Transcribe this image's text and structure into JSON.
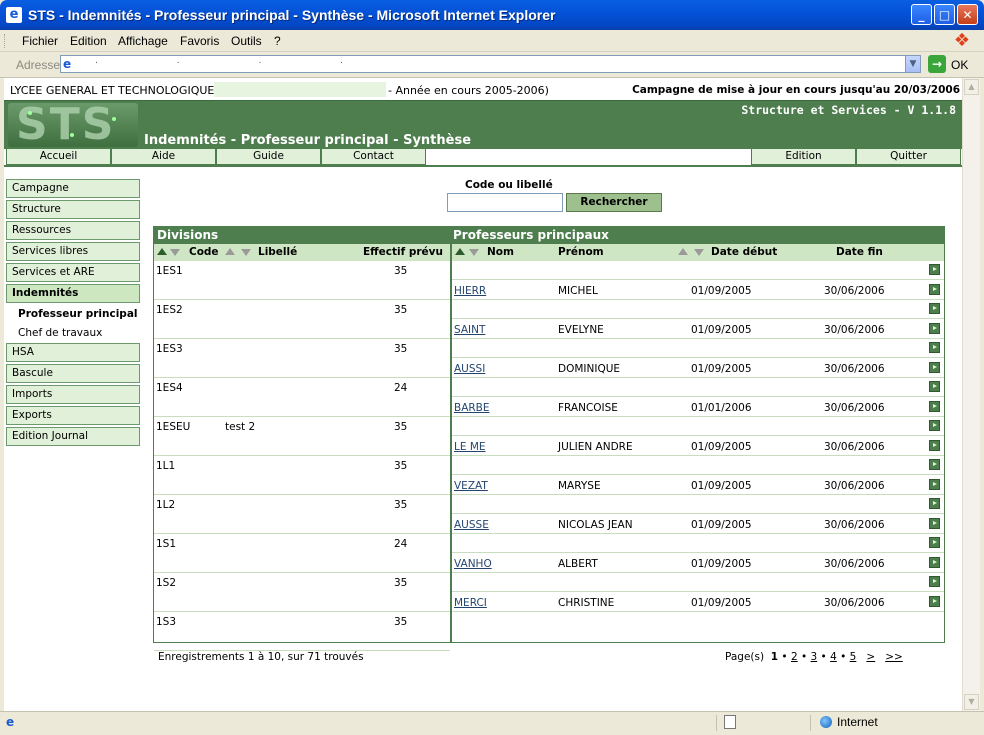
{
  "window": {
    "title": "STS - Indemnités - Professeur principal - Synthèse - Microsoft Internet Explorer",
    "min": "_",
    "max": "□",
    "close": "✕"
  },
  "menu": [
    "Fichier",
    "Edition",
    "Affichage",
    "Favoris",
    "Outils",
    "?"
  ],
  "address": {
    "label": "Adresse",
    "value": ". . . .",
    "go_label": "OK"
  },
  "status": {
    "zone": "Internet"
  },
  "header": {
    "school": "LYCEE GENERAL ET TECHNOLOGIQUE",
    "year": "- Année en cours 2005-2006)",
    "campagne": "Campagne de mise à jour en cours jusqu'au 20/03/2006",
    "logo": "STS",
    "version": "Structure et Services - V 1.1.8",
    "page_title": "Indemnités - Professeur principal - Synthèse"
  },
  "nav": {
    "left": [
      "Accueil",
      "Aide",
      "Guide",
      "Contact"
    ],
    "right": [
      "Edition",
      "Quitter"
    ]
  },
  "sidebar": {
    "items": [
      "Campagne",
      "Structure",
      "Ressources",
      "Services libres",
      "Services et ARE",
      "Indemnités"
    ],
    "sub": [
      "Professeur principal",
      "Chef de travaux"
    ],
    "items2": [
      "HSA",
      "Bascule",
      "Imports",
      "Exports",
      "Edition Journal"
    ]
  },
  "search": {
    "label": "Code ou libellé",
    "value": "",
    "button": "Rechercher"
  },
  "table": {
    "divisions_title": "Divisions",
    "professeurs_title": "Professeurs principaux",
    "div_cols": [
      "Code",
      "Libellé",
      "Effectif prévu"
    ],
    "prof_cols": [
      "Nom",
      "Prénom",
      "Date début",
      "Date fin"
    ],
    "divisions": [
      {
        "code": "1ES1",
        "libelle": "",
        "effectif": "35"
      },
      {
        "code": "1ES2",
        "libelle": "",
        "effectif": "35"
      },
      {
        "code": "1ES3",
        "libelle": "",
        "effectif": "35"
      },
      {
        "code": "1ES4",
        "libelle": "",
        "effectif": "24"
      },
      {
        "code": "1ESEU",
        "libelle": "test 2",
        "effectif": "35"
      },
      {
        "code": "1L1",
        "libelle": "",
        "effectif": "35"
      },
      {
        "code": "1L2",
        "libelle": "",
        "effectif": "35"
      },
      {
        "code": "1S1",
        "libelle": "",
        "effectif": "24"
      },
      {
        "code": "1S2",
        "libelle": "",
        "effectif": "35"
      },
      {
        "code": "1S3",
        "libelle": "",
        "effectif": "35"
      }
    ],
    "professeurs": [
      {
        "nom": "",
        "prenom": "",
        "debut": "",
        "fin": ""
      },
      {
        "nom": "HIERR",
        "prenom": "MICHEL",
        "debut": "01/09/2005",
        "fin": "30/06/2006"
      },
      {
        "nom": "",
        "prenom": "",
        "debut": "",
        "fin": ""
      },
      {
        "nom": "SAINT",
        "prenom": "EVELYNE",
        "debut": "01/09/2005",
        "fin": "30/06/2006"
      },
      {
        "nom": "",
        "prenom": "",
        "debut": "",
        "fin": ""
      },
      {
        "nom": "AUSSI",
        "prenom": "DOMINIQUE",
        "debut": "01/09/2005",
        "fin": "30/06/2006"
      },
      {
        "nom": "",
        "prenom": "",
        "debut": "",
        "fin": ""
      },
      {
        "nom": "BARBE",
        "prenom": "FRANCOISE",
        "debut": "01/01/2006",
        "fin": "30/06/2006"
      },
      {
        "nom": "",
        "prenom": "",
        "debut": "",
        "fin": ""
      },
      {
        "nom": "LE ME",
        "prenom": "JULIEN ANDRE",
        "debut": "01/09/2005",
        "fin": "30/06/2006"
      },
      {
        "nom": "",
        "prenom": "",
        "debut": "",
        "fin": ""
      },
      {
        "nom": "VEZAT",
        "prenom": "MARYSE",
        "debut": "01/09/2005",
        "fin": "30/06/2006"
      },
      {
        "nom": "",
        "prenom": "",
        "debut": "",
        "fin": ""
      },
      {
        "nom": "AUSSE",
        "prenom": "NICOLAS JEAN",
        "debut": "01/09/2005",
        "fin": "30/06/2006"
      },
      {
        "nom": "",
        "prenom": "",
        "debut": "",
        "fin": ""
      },
      {
        "nom": "VANHO",
        "prenom": "ALBERT",
        "debut": "01/09/2005",
        "fin": "30/06/2006"
      },
      {
        "nom": "",
        "prenom": "",
        "debut": "",
        "fin": ""
      },
      {
        "nom": "MERCI",
        "prenom": "CHRISTINE",
        "debut": "01/09/2005",
        "fin": "30/06/2006"
      }
    ]
  },
  "footer": {
    "records": "Enregistrements 1 à 10, sur 71 trouvés",
    "pages_label": "Page(s)",
    "pages": [
      "1",
      "2",
      "3",
      "4",
      "5"
    ],
    "next": ">",
    "last": ">>"
  },
  "colors": {
    "brand_green": "#4e7e4e",
    "light_green": "#e1f0d9",
    "xp_blue": "#0453d8"
  }
}
